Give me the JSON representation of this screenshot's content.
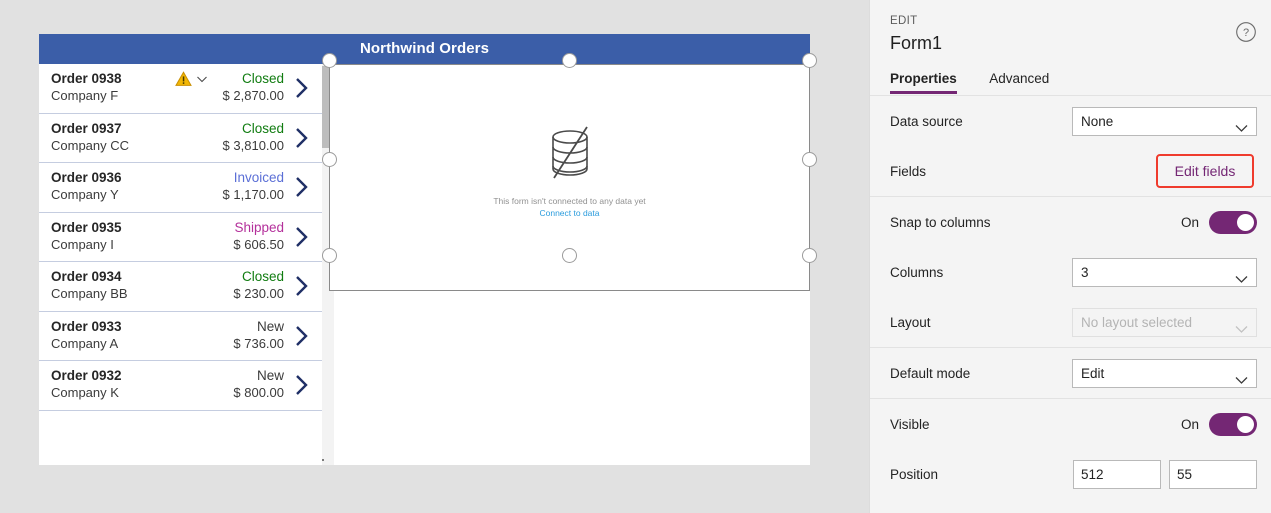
{
  "canvas": {
    "screen_title": "Northwind Orders",
    "gallery": {
      "rows": [
        {
          "order": "Order 0938",
          "company": "Company F",
          "status": "Closed",
          "status_color": "#107c10",
          "amount": "$ 2,870.00",
          "has_warning": true
        },
        {
          "order": "Order 0937",
          "company": "Company CC",
          "status": "Closed",
          "status_color": "#107c10",
          "amount": "$ 3,810.00",
          "has_warning": false
        },
        {
          "order": "Order 0936",
          "company": "Company Y",
          "status": "Invoiced",
          "status_color": "#5b6fd6",
          "amount": "$ 1,170.00",
          "has_warning": false
        },
        {
          "order": "Order 0935",
          "company": "Company I",
          "status": "Shipped",
          "status_color": "#b4309b",
          "amount": "$ 606.50",
          "has_warning": false
        },
        {
          "order": "Order 0934",
          "company": "Company BB",
          "status": "Closed",
          "status_color": "#107c10",
          "amount": "$ 230.00",
          "has_warning": false
        },
        {
          "order": "Order 0933",
          "company": "Company A",
          "status": "New",
          "status_color": "#3b3b3b",
          "amount": "$ 736.00",
          "has_warning": false
        },
        {
          "order": "Order 0932",
          "company": "Company K",
          "status": "New",
          "status_color": "#3b3b3b",
          "amount": "$ 800.00",
          "has_warning": false
        }
      ]
    },
    "form": {
      "empty_message": "This form isn't connected to any data yet",
      "connect_link": "Connect to data",
      "icon": "database-disconnected-icon",
      "selected": true
    }
  },
  "panel": {
    "eyebrow": "EDIT",
    "title": "Form1",
    "help_icon": "help-circle-icon",
    "tabs": [
      {
        "label": "Properties",
        "active": true
      },
      {
        "label": "Advanced",
        "active": false
      }
    ],
    "properties": {
      "data_source": {
        "label": "Data source",
        "value": "None"
      },
      "fields": {
        "label": "Fields",
        "button_label": "Edit fields",
        "highlight_color": "#ef3b2d",
        "button_text_color": "#742774"
      },
      "snap_to_columns": {
        "label": "Snap to columns",
        "state": "On"
      },
      "columns": {
        "label": "Columns",
        "value": "3"
      },
      "layout": {
        "label": "Layout",
        "value": "No layout selected",
        "disabled": true
      },
      "default_mode": {
        "label": "Default mode",
        "value": "Edit"
      },
      "visible": {
        "label": "Visible",
        "state": "On"
      },
      "position": {
        "label": "Position",
        "x": "512",
        "y": "55"
      }
    },
    "accent_color": "#742774"
  }
}
